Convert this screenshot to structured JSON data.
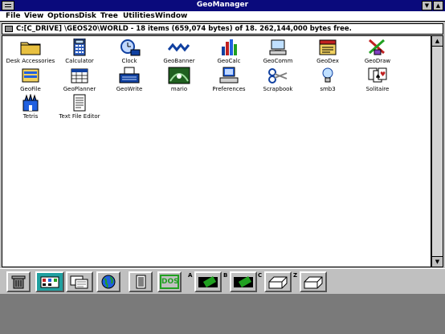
{
  "window": {
    "title": "GeoManager",
    "min_glyph": "▼",
    "max_glyph": "▲"
  },
  "menu": [
    {
      "label": "File"
    },
    {
      "label": "View"
    },
    {
      "label": "Options"
    },
    {
      "label": "Disk"
    },
    {
      "label": "Tree"
    },
    {
      "label": "Utilities"
    },
    {
      "label": "Window"
    }
  ],
  "path_bar": {
    "text": "C:[C_DRIVE] \\GEOS20\\WORLD - 18 items (659,074 bytes) of 18.  262,144,000 bytes free."
  },
  "scrollbar": {
    "up": "▲",
    "down": "▼"
  },
  "icons": [
    {
      "label": "Desk Accessories",
      "icon": "folder-icon"
    },
    {
      "label": "Calculator",
      "icon": "calculator-icon"
    },
    {
      "label": "Clock",
      "icon": "clock-icon"
    },
    {
      "label": "GeoBanner",
      "icon": "geobanner-icon"
    },
    {
      "label": "GeoCalc",
      "icon": "geocalc-icon"
    },
    {
      "label": "GeoComm",
      "icon": "geocomm-icon"
    },
    {
      "label": "GeoDex",
      "icon": "geodex-icon"
    },
    {
      "label": "GeoDraw",
      "icon": "geodraw-icon"
    },
    {
      "label": "GeoFile",
      "icon": "geofile-icon"
    },
    {
      "label": "GeoPlanner",
      "icon": "geoplanner-icon"
    },
    {
      "label": "GeoWrite",
      "icon": "geowrite-icon"
    },
    {
      "label": "mario",
      "icon": "mario-icon"
    },
    {
      "label": "Preferences",
      "icon": "preferences-icon"
    },
    {
      "label": "Scrapbook",
      "icon": "scrapbook-icon"
    },
    {
      "label": "smb3",
      "icon": "smb3-icon"
    },
    {
      "label": "Solitaire",
      "icon": "solitaire-icon"
    },
    {
      "label": "Tetris",
      "icon": "tetris-icon"
    },
    {
      "label": "Text File Editor",
      "icon": "text-file-editor-icon"
    }
  ],
  "taskbar": {
    "dos_label": "DOS",
    "drives": [
      {
        "letter": "A"
      },
      {
        "letter": "B"
      },
      {
        "letter": "C"
      },
      {
        "letter": "Z"
      }
    ]
  }
}
